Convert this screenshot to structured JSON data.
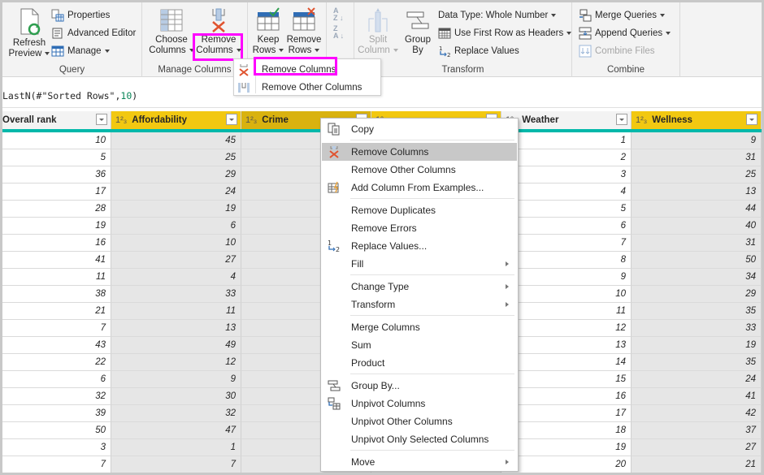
{
  "ribbon": {
    "query_group": {
      "label": "Query",
      "refresh_preview": [
        "Refresh",
        "Preview"
      ],
      "properties": "Properties",
      "advanced_editor": "Advanced Editor",
      "manage": "Manage"
    },
    "manage_columns_group": {
      "label": "Manage Columns",
      "choose_columns": [
        "Choose",
        "Columns"
      ],
      "remove_columns": [
        "Remove",
        "Columns"
      ]
    },
    "reduce_rows_group": {
      "keep_rows": [
        "Keep",
        "Rows"
      ],
      "remove_rows": [
        "Remove",
        "Rows"
      ]
    },
    "transform_group": {
      "label": "Transform",
      "split_column": [
        "Split",
        "Column"
      ],
      "group_by": [
        "Group",
        "By"
      ],
      "data_type": "Data Type: Whole Number",
      "use_first_row": "Use First Row as Headers",
      "replace_values": "Replace Values"
    },
    "combine_group": {
      "label": "Combine",
      "merge_queries": "Merge Queries",
      "append_queries": "Append Queries",
      "combine_files": "Combine Files"
    },
    "highlight_color": "#ff00ff"
  },
  "remove_columns_dropdown": {
    "items": [
      "Remove Columns",
      "Remove Other Columns"
    ]
  },
  "formula_bar": {
    "prefix": "LastN(#\"Sorted Rows\",",
    "number": "10",
    "suffix": ")"
  },
  "grid": {
    "columns": [
      {
        "name": "Overall rank",
        "type": "",
        "selected": false
      },
      {
        "name": "Affordability",
        "type": "1²₃",
        "selected": true
      },
      {
        "name": "Crime",
        "type": "1²₃",
        "selected": true
      },
      {
        "name": "",
        "type": "1²₃",
        "selected": true
      },
      {
        "name": "Weather",
        "type": "1²₃",
        "selected": false
      },
      {
        "name": "Wellness",
        "type": "1²₃",
        "selected": true
      }
    ],
    "overall_rank": [
      "10",
      "5",
      "36",
      "17",
      "28",
      "19",
      "16",
      "41",
      "11",
      "38",
      "21",
      "7",
      "43",
      "22",
      "6",
      "32",
      "39",
      "50",
      "3",
      "7"
    ],
    "affordability": [
      "45",
      "25",
      "29",
      "24",
      "19",
      "6",
      "10",
      "27",
      "4",
      "33",
      "11",
      "13",
      "49",
      "12",
      "9",
      "30",
      "32",
      "47",
      "1",
      "7"
    ],
    "weather": [
      "1",
      "2",
      "3",
      "4",
      "5",
      "6",
      "7",
      "8",
      "9",
      "10",
      "11",
      "12",
      "13",
      "14",
      "15",
      "16",
      "17",
      "18",
      "19",
      "20"
    ],
    "wellness": [
      "9",
      "31",
      "25",
      "13",
      "44",
      "40",
      "31",
      "50",
      "34",
      "29",
      "35",
      "33",
      "19",
      "35",
      "24",
      "41",
      "42",
      "37",
      "27",
      "21"
    ],
    "header_color": "#f2c811",
    "quality_bar_color": "#01b8aa"
  },
  "context_menu": {
    "items": [
      {
        "label": "Copy",
        "icon": "copy-icon"
      },
      {
        "label": "Remove Columns",
        "icon": "remove-columns-icon",
        "highlighted": true
      },
      {
        "label": "Remove Other Columns",
        "icon": ""
      },
      {
        "label": "Add Column From Examples...",
        "icon": "add-column-examples-icon"
      },
      {
        "label": "Remove Duplicates",
        "icon": ""
      },
      {
        "label": "Remove Errors",
        "icon": ""
      },
      {
        "label": "Replace Values...",
        "icon": "replace-values-icon"
      },
      {
        "label": "Fill",
        "icon": "",
        "submenu": true
      },
      {
        "label": "Change Type",
        "icon": "",
        "submenu": true
      },
      {
        "label": "Transform",
        "icon": "",
        "submenu": true
      },
      {
        "label": "Merge Columns",
        "icon": ""
      },
      {
        "label": "Sum",
        "icon": ""
      },
      {
        "label": "Product",
        "icon": ""
      },
      {
        "label": "Group By...",
        "icon": "group-by-icon"
      },
      {
        "label": "Unpivot Columns",
        "icon": "unpivot-icon"
      },
      {
        "label": "Unpivot Other Columns",
        "icon": ""
      },
      {
        "label": "Unpivot Only Selected Columns",
        "icon": ""
      },
      {
        "label": "Move",
        "icon": "",
        "submenu": true
      }
    ]
  }
}
